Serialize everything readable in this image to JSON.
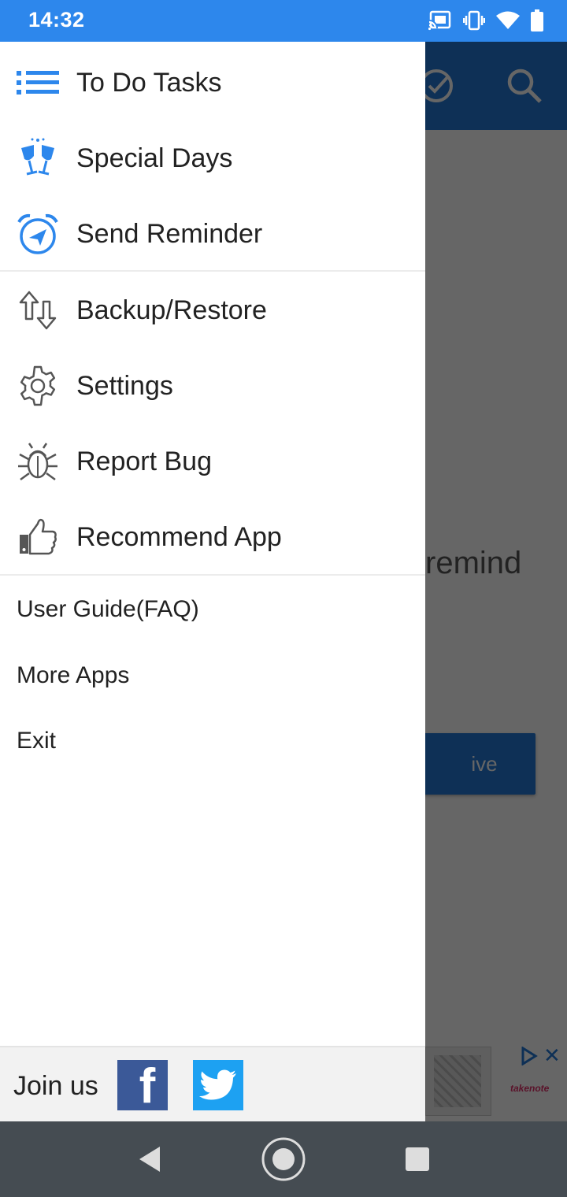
{
  "status_bar": {
    "time": "14:32",
    "icons": [
      "cast-icon",
      "vibrate-icon",
      "wifi-icon",
      "battery-icon"
    ],
    "color": "#2d87ec"
  },
  "background_app": {
    "toolbar_icons": [
      "check-circle-icon",
      "search-icon"
    ],
    "partial_text": "remind",
    "partial_button": "ive",
    "ad_brand": "takenote",
    "accent": "#2479d6"
  },
  "drawer": {
    "primary_items": [
      {
        "label": "To Do Tasks",
        "icon": "list-icon"
      },
      {
        "label": "Special Days",
        "icon": "cheers-glasses-icon"
      },
      {
        "label": "Send Reminder",
        "icon": "alarm-send-icon"
      }
    ],
    "secondary_items": [
      {
        "label": "Backup/Restore",
        "icon": "up-down-arrows-icon"
      },
      {
        "label": "Settings",
        "icon": "gear-icon"
      },
      {
        "label": "Report Bug",
        "icon": "bug-icon"
      },
      {
        "label": "Recommend App",
        "icon": "thumbs-up-icon"
      }
    ],
    "text_items": [
      {
        "label": "User Guide(FAQ)"
      },
      {
        "label": "More Apps"
      },
      {
        "label": "Exit"
      }
    ],
    "footer": {
      "label": "Join us",
      "social": [
        "facebook-icon",
        "twitter-icon"
      ]
    }
  },
  "nav_bar": {
    "buttons": [
      "back-icon",
      "home-icon",
      "recents-icon"
    ]
  }
}
